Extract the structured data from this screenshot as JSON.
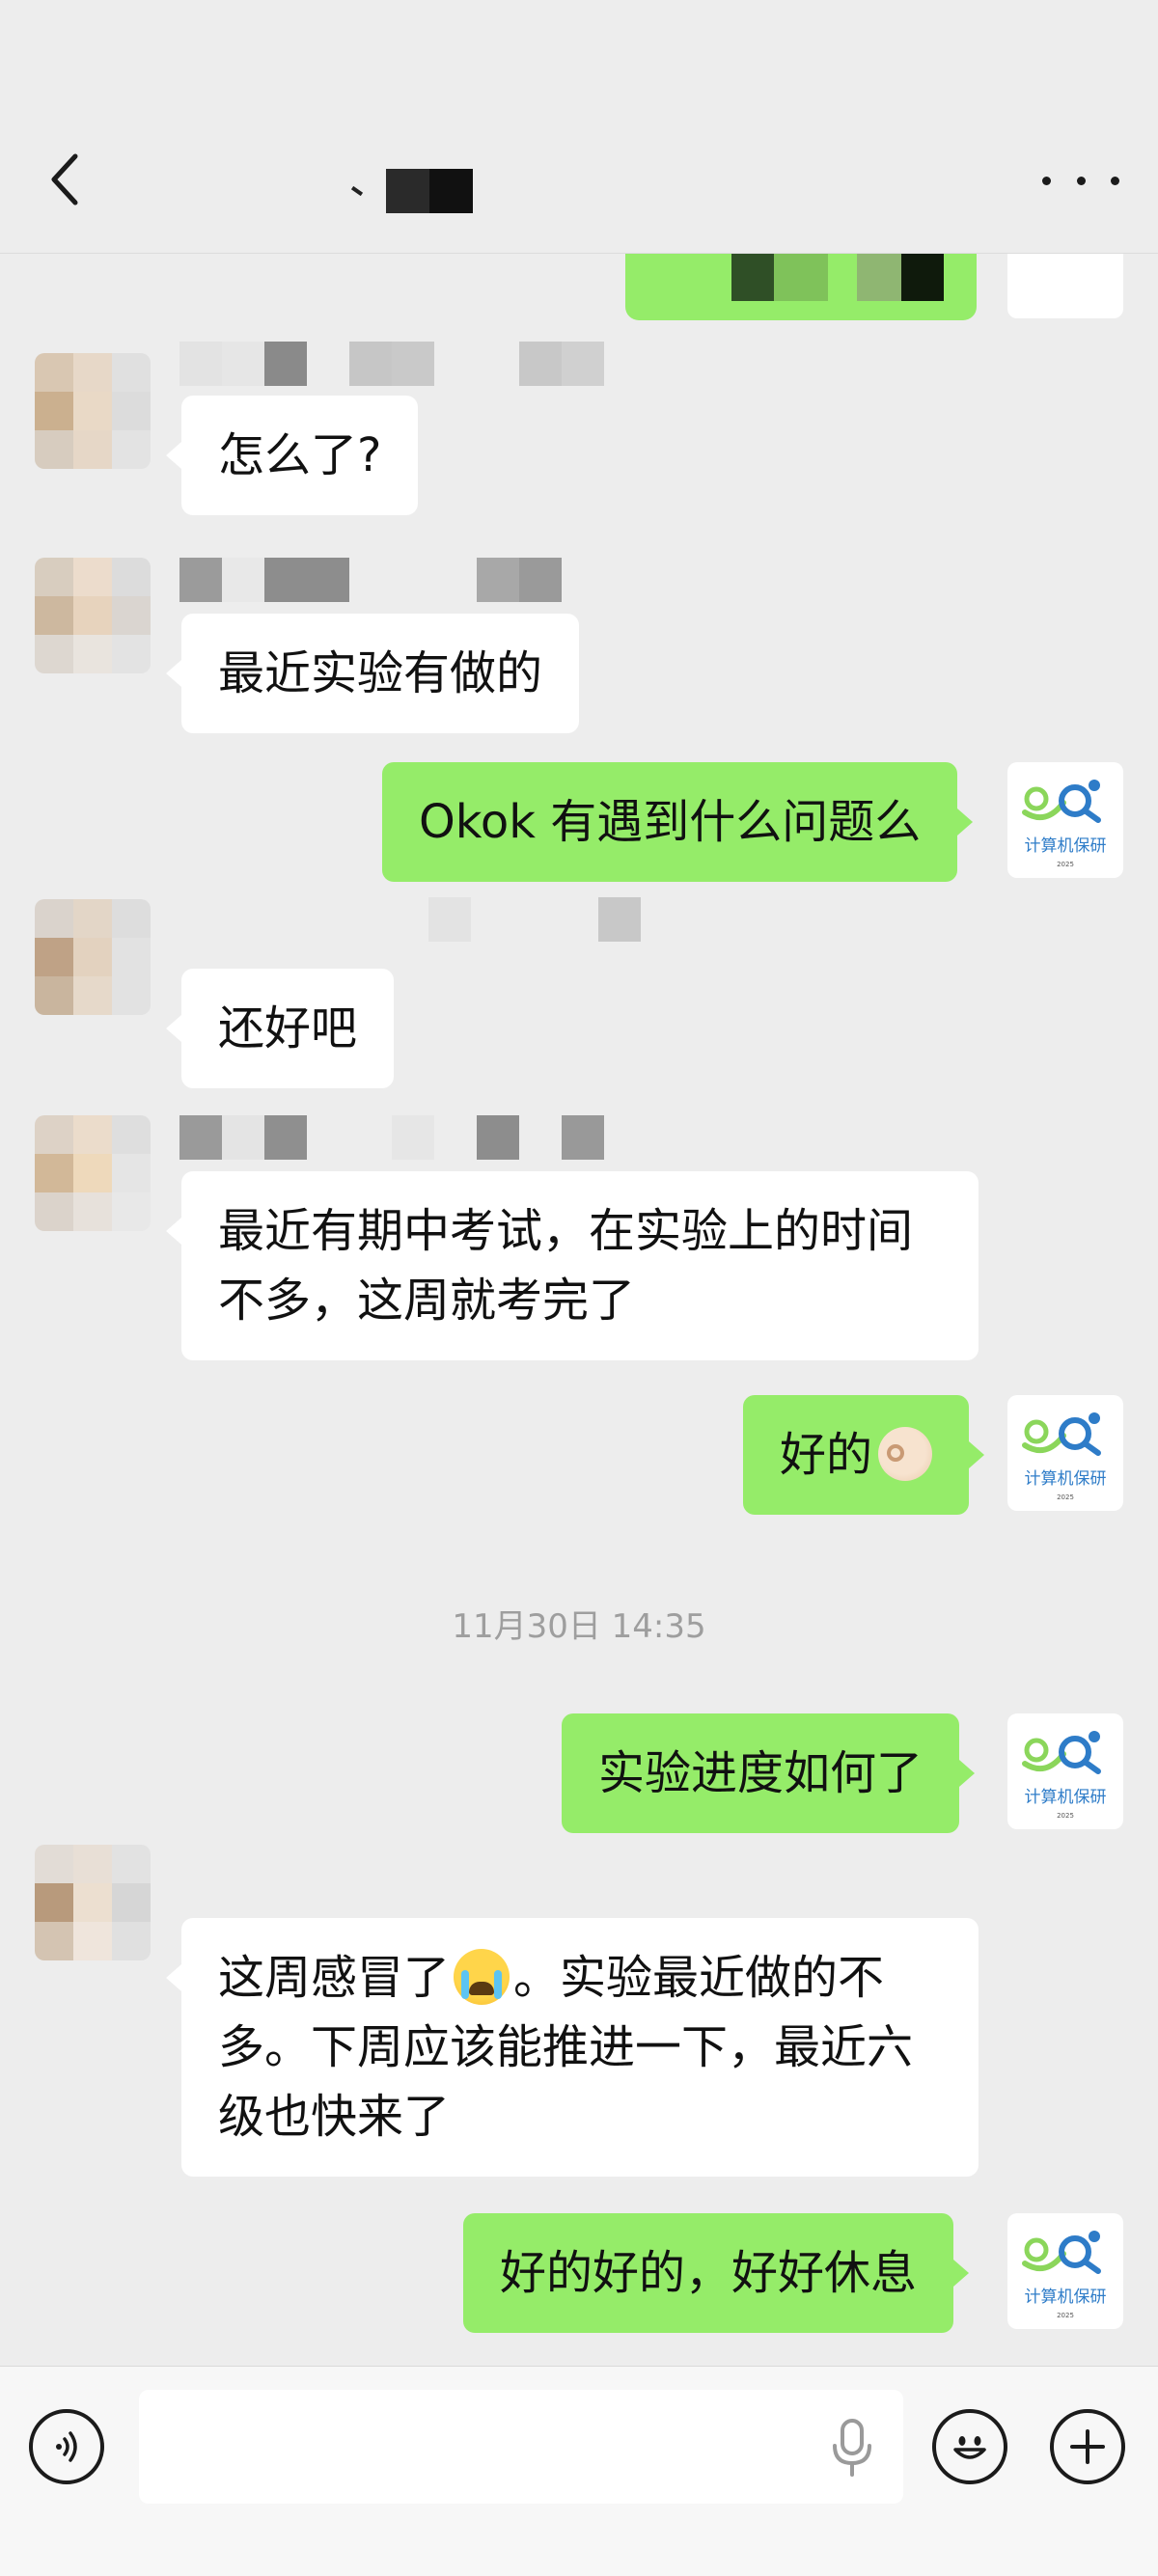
{
  "header": {
    "title": "、",
    "back_icon": "chevron-left-icon",
    "more_icon": "more-horizontal-icon"
  },
  "my_avatar_label": "计算机保研",
  "my_avatar_sublabel": "2025",
  "messages": [
    {
      "side": "in",
      "text": "怎么了?"
    },
    {
      "side": "in",
      "text": "最近实验有做的"
    },
    {
      "side": "out",
      "text": "Okok 有遇到什么问题么"
    },
    {
      "side": "in",
      "text": "还好吧"
    },
    {
      "side": "in",
      "text": "最近有期中考试，在实验上的时间不多，这周就考完了"
    },
    {
      "side": "out",
      "text": "好的"
    },
    {
      "side": "out",
      "text": "实验进度如何了"
    },
    {
      "side": "in",
      "text_a": "这周感冒了",
      "text_b": "。实验最近做的不多。下周应该能推进一下，最近六级也快来了"
    },
    {
      "side": "out",
      "text": "好的好的，好好休息"
    }
  ],
  "timestamp": "11月30日 14:35",
  "input": {
    "value": "",
    "voice_icon": "voice-mode-icon",
    "mic_icon": "microphone-icon",
    "emoji_icon": "emoji-icon",
    "add_icon": "plus-icon"
  },
  "colors": {
    "background": "#EDEDED",
    "outgoing_bubble": "#95EC69",
    "incoming_bubble": "#FFFFFF",
    "timestamp_text": "#9E9E9E"
  }
}
